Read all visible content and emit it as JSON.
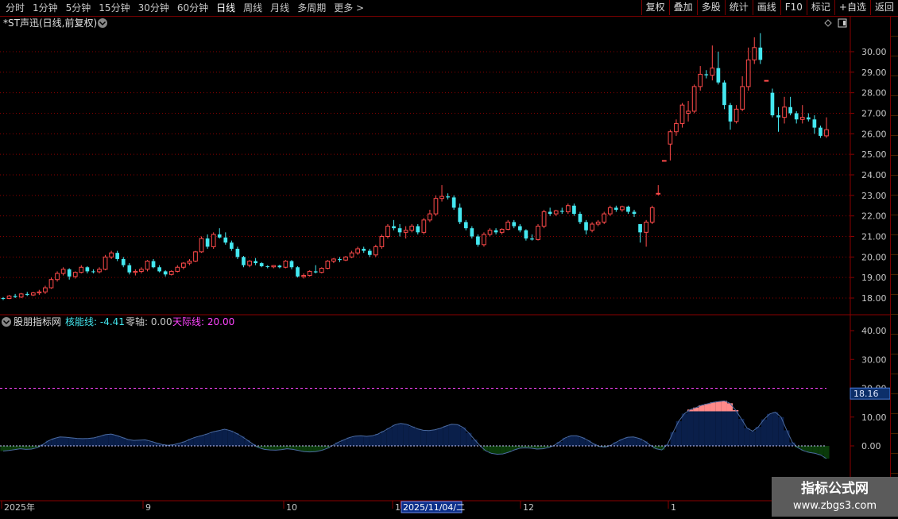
{
  "toolbar": {
    "periods": [
      "分时",
      "1分钟",
      "5分钟",
      "15分钟",
      "30分钟",
      "60分钟",
      "日线",
      "周线",
      "月线",
      "多周期",
      "更多 >"
    ],
    "active_period": "日线",
    "buttons": [
      "复权",
      "叠加",
      "多股",
      "统计",
      "画线",
      "F10",
      "标记",
      "+自选",
      "返回"
    ]
  },
  "main_chart": {
    "title": "*ST声迅(日线,前复权)",
    "y_ticks": [
      "30.00",
      "29.00",
      "28.00",
      "27.00",
      "26.00",
      "25.00",
      "24.00",
      "23.00",
      "22.00",
      "21.00",
      "20.00",
      "19.00",
      "18.00"
    ]
  },
  "indicator": {
    "name": "股朋指标网",
    "line1_label": "核能线: -4.41",
    "line2_label": "零轴: 0.00",
    "line3_label": "天际线: 20.00",
    "y_ticks": [
      "40.00",
      "30.00",
      "20.00",
      "10.00",
      "0.00"
    ],
    "level_badge": "18.16"
  },
  "date_axis": {
    "labels": [
      "2025年",
      "9",
      "10",
      "1",
      "2025/11/04/二",
      "12",
      "1"
    ],
    "highlight": "2025/11/04/二"
  },
  "watermark": {
    "title": "指标公式网",
    "url": "www.zbgs3.com"
  },
  "colors": {
    "up": "#ff4a4a",
    "down": "#44e8f0",
    "grid_dots": "#8a0000",
    "skyline": "#ff44ff",
    "energy_pos": "#0a1f4a",
    "energy_neg": "#0a3a0a",
    "energy_hi": "#ff8a8a"
  },
  "chart_data": {
    "type": "candlestick",
    "candles": [
      [
        18.0,
        18.05,
        17.9,
        17.98
      ],
      [
        17.98,
        18.15,
        17.95,
        18.1
      ],
      [
        18.1,
        18.2,
        18.0,
        18.05
      ],
      [
        18.05,
        18.25,
        18.0,
        18.2
      ],
      [
        18.2,
        18.3,
        18.1,
        18.15
      ],
      [
        18.15,
        18.3,
        18.1,
        18.25
      ],
      [
        18.25,
        18.4,
        18.15,
        18.3
      ],
      [
        18.3,
        18.6,
        18.2,
        18.5
      ],
      [
        18.5,
        19.0,
        18.45,
        18.9
      ],
      [
        18.9,
        19.3,
        18.8,
        19.2
      ],
      [
        19.2,
        19.5,
        19.1,
        19.4
      ],
      [
        19.4,
        19.45,
        18.9,
        19.05
      ],
      [
        19.05,
        19.3,
        18.95,
        19.25
      ],
      [
        19.25,
        19.6,
        19.2,
        19.5
      ],
      [
        19.5,
        19.55,
        19.2,
        19.3
      ],
      [
        19.3,
        19.4,
        19.2,
        19.28
      ],
      [
        19.28,
        19.5,
        19.2,
        19.4
      ],
      [
        19.4,
        20.1,
        19.35,
        20.0
      ],
      [
        20.0,
        20.3,
        19.9,
        20.2
      ],
      [
        20.2,
        20.3,
        19.8,
        19.9
      ],
      [
        19.9,
        20.0,
        19.5,
        19.6
      ],
      [
        19.6,
        19.7,
        19.15,
        19.25
      ],
      [
        19.25,
        19.4,
        19.1,
        19.3
      ],
      [
        19.3,
        19.5,
        19.2,
        19.4
      ],
      [
        19.4,
        19.85,
        19.3,
        19.8
      ],
      [
        19.8,
        19.9,
        19.45,
        19.5
      ],
      [
        19.5,
        19.6,
        19.25,
        19.3
      ],
      [
        19.3,
        19.35,
        19.05,
        19.15
      ],
      [
        19.15,
        19.35,
        19.1,
        19.3
      ],
      [
        19.3,
        19.6,
        19.25,
        19.5
      ],
      [
        19.5,
        19.75,
        19.4,
        19.7
      ],
      [
        19.7,
        19.9,
        19.6,
        19.8
      ],
      [
        19.8,
        20.3,
        19.75,
        20.25
      ],
      [
        20.25,
        21.0,
        20.2,
        20.9
      ],
      [
        20.9,
        21.1,
        20.4,
        20.5
      ],
      [
        20.5,
        21.2,
        20.4,
        21.1
      ],
      [
        21.1,
        21.4,
        20.9,
        20.95
      ],
      [
        20.95,
        21.2,
        20.6,
        20.7
      ],
      [
        20.7,
        20.8,
        20.3,
        20.4
      ],
      [
        20.4,
        20.5,
        19.9,
        20.0
      ],
      [
        20.0,
        20.05,
        19.5,
        19.6
      ],
      [
        19.6,
        19.85,
        19.5,
        19.8
      ],
      [
        19.8,
        19.95,
        19.6,
        19.7
      ],
      [
        19.7,
        19.75,
        19.5,
        19.55
      ],
      [
        19.55,
        19.6,
        19.45,
        19.52
      ],
      [
        19.52,
        19.6,
        19.45,
        19.58
      ],
      [
        19.58,
        19.62,
        19.45,
        19.5
      ],
      [
        19.5,
        19.85,
        19.45,
        19.8
      ],
      [
        19.8,
        19.85,
        19.4,
        19.5
      ],
      [
        19.5,
        19.55,
        19.0,
        19.05
      ],
      [
        19.05,
        19.2,
        18.95,
        19.1
      ],
      [
        19.1,
        19.35,
        19.05,
        19.3
      ],
      [
        19.3,
        19.6,
        19.2,
        19.25
      ],
      [
        19.25,
        19.5,
        19.2,
        19.45
      ],
      [
        19.45,
        19.85,
        19.4,
        19.8
      ],
      [
        19.8,
        19.95,
        19.7,
        19.9
      ],
      [
        19.9,
        20.0,
        19.75,
        19.85
      ],
      [
        19.85,
        20.05,
        19.8,
        20.0
      ],
      [
        20.0,
        20.3,
        19.95,
        20.2
      ],
      [
        20.2,
        20.5,
        20.1,
        20.4
      ],
      [
        20.4,
        20.5,
        20.2,
        20.3
      ],
      [
        20.3,
        20.4,
        20.0,
        20.1
      ],
      [
        20.1,
        20.6,
        20.0,
        20.5
      ],
      [
        20.5,
        21.1,
        20.4,
        21.0
      ],
      [
        21.0,
        21.6,
        20.9,
        21.5
      ],
      [
        21.5,
        21.8,
        21.3,
        21.4
      ],
      [
        21.4,
        21.6,
        21.0,
        21.2
      ],
      [
        21.2,
        21.5,
        20.9,
        21.3
      ],
      [
        21.3,
        21.6,
        21.2,
        21.5
      ],
      [
        21.5,
        21.6,
        21.1,
        21.2
      ],
      [
        21.2,
        21.9,
        21.1,
        21.8
      ],
      [
        21.8,
        22.3,
        21.7,
        22.1
      ],
      [
        22.1,
        23.0,
        22.0,
        22.85
      ],
      [
        22.85,
        23.5,
        22.7,
        22.95
      ],
      [
        22.95,
        23.1,
        22.8,
        22.9
      ],
      [
        22.9,
        23.0,
        22.3,
        22.4
      ],
      [
        22.4,
        22.6,
        21.6,
        21.7
      ],
      [
        21.7,
        21.8,
        21.3,
        21.4
      ],
      [
        21.4,
        21.5,
        20.9,
        21.0
      ],
      [
        21.0,
        21.1,
        20.5,
        20.6
      ],
      [
        20.6,
        21.2,
        20.5,
        21.1
      ],
      [
        21.1,
        21.4,
        21.0,
        21.3
      ],
      [
        21.3,
        21.4,
        21.1,
        21.2
      ],
      [
        21.2,
        21.4,
        21.1,
        21.35
      ],
      [
        21.35,
        21.8,
        21.3,
        21.7
      ],
      [
        21.7,
        21.8,
        21.4,
        21.5
      ],
      [
        21.5,
        21.6,
        21.2,
        21.3
      ],
      [
        21.3,
        21.35,
        20.8,
        20.9
      ],
      [
        20.9,
        21.1,
        20.8,
        20.85
      ],
      [
        20.85,
        21.6,
        20.8,
        21.5
      ],
      [
        21.5,
        22.3,
        21.4,
        22.2
      ],
      [
        22.2,
        22.4,
        22.0,
        22.1
      ],
      [
        22.1,
        22.3,
        22.0,
        22.25
      ],
      [
        22.25,
        22.4,
        22.1,
        22.2
      ],
      [
        22.2,
        22.6,
        22.1,
        22.5
      ],
      [
        22.5,
        22.6,
        22.0,
        22.1
      ],
      [
        22.1,
        22.2,
        21.6,
        21.7
      ],
      [
        21.7,
        21.8,
        21.1,
        21.3
      ],
      [
        21.3,
        21.7,
        21.2,
        21.6
      ],
      [
        21.6,
        21.8,
        21.5,
        21.7
      ],
      [
        21.7,
        22.2,
        21.6,
        22.1
      ],
      [
        22.1,
        22.5,
        22.0,
        22.4
      ],
      [
        22.4,
        22.5,
        22.2,
        22.3
      ],
      [
        22.3,
        22.5,
        22.2,
        22.45
      ],
      [
        22.45,
        22.5,
        22.1,
        22.2
      ],
      [
        22.2,
        22.3,
        21.95,
        22.1
      ],
      [
        21.6,
        21.6,
        20.7,
        21.2
      ],
      [
        21.2,
        21.8,
        20.5,
        21.7
      ],
      [
        21.7,
        22.5,
        21.6,
        22.4
      ],
      [
        23.1,
        23.5,
        23.0,
        23.1
      ],
      [
        24.7,
        24.7,
        24.7,
        24.7
      ],
      [
        25.5,
        26.2,
        24.7,
        26.1
      ],
      [
        26.1,
        26.7,
        25.9,
        26.5
      ],
      [
        26.5,
        27.5,
        26.3,
        27.4
      ],
      [
        27.0,
        27.6,
        26.6,
        27.1
      ],
      [
        27.1,
        28.4,
        27.0,
        28.3
      ],
      [
        28.3,
        29.3,
        28.1,
        28.9
      ],
      [
        28.9,
        29.1,
        28.7,
        28.85
      ],
      [
        28.85,
        30.3,
        28.6,
        29.2
      ],
      [
        29.2,
        30.0,
        28.4,
        28.5
      ],
      [
        28.5,
        28.6,
        27.2,
        27.4
      ],
      [
        27.4,
        27.5,
        26.2,
        26.6
      ],
      [
        26.6,
        27.4,
        26.5,
        27.2
      ],
      [
        27.2,
        28.8,
        27.1,
        28.3
      ],
      [
        28.3,
        30.2,
        28.1,
        29.6
      ],
      [
        29.6,
        30.7,
        29.4,
        30.2
      ],
      [
        30.2,
        30.9,
        29.4,
        29.6
      ],
      [
        28.6,
        28.6,
        28.6,
        28.6
      ],
      [
        28.0,
        28.2,
        26.8,
        26.9
      ],
      [
        26.9,
        27.3,
        26.1,
        26.8
      ],
      [
        26.8,
        27.8,
        26.5,
        27.3
      ],
      [
        27.3,
        27.8,
        26.9,
        27.0
      ],
      [
        27.0,
        27.1,
        26.5,
        26.7
      ],
      [
        26.7,
        27.4,
        26.5,
        26.8
      ],
      [
        26.8,
        27.0,
        26.6,
        26.7
      ],
      [
        26.7,
        26.9,
        26.0,
        26.3
      ],
      [
        26.3,
        26.4,
        25.8,
        25.9
      ],
      [
        25.9,
        26.8,
        25.8,
        26.2
      ]
    ],
    "indicator_series": [
      {
        "name": "核能线",
        "values": [
          -1.8,
          -1.6,
          -1.3,
          -1.0,
          -1.2,
          -1.1,
          -0.6,
          0.5,
          1.8,
          2.6,
          3.1,
          3.0,
          2.8,
          2.6,
          2.5,
          2.6,
          2.8,
          3.3,
          3.9,
          4.1,
          3.6,
          2.9,
          2.2,
          1.9,
          2.0,
          2.1,
          1.6,
          1.0,
          0.5,
          0.2,
          0.4,
          0.9,
          1.5,
          2.4,
          3.1,
          3.6,
          4.2,
          4.9,
          5.3,
          5.8,
          5.3,
          4.4,
          3.3,
          2.0,
          0.6,
          -0.6,
          -1.2,
          -1.4,
          -1.5,
          -1.3,
          -1.0,
          -1.2,
          -1.6,
          -2.0,
          -2.1,
          -2.0,
          -1.6,
          -0.9,
          0.1,
          1.2,
          2.1,
          2.9,
          3.4,
          3.5,
          3.3,
          3.5,
          4.1,
          5.1,
          6.2,
          7.3,
          7.8,
          7.5,
          6.7,
          5.9,
          5.4,
          5.3,
          5.6,
          6.1,
          6.9,
          7.5,
          7.4,
          6.4,
          4.5,
          2.2,
          0.0,
          -1.7,
          -2.6,
          -2.9,
          -2.8,
          -2.2,
          -1.4,
          -0.8,
          -0.7,
          -0.8,
          -1.1,
          -1.0,
          -0.6,
          0.1,
          1.4,
          2.8,
          3.5,
          3.5,
          2.9,
          1.9,
          0.7,
          -0.2,
          -0.4,
          0.2,
          1.3,
          2.3,
          3.0,
          3.1,
          2.6,
          1.6,
          0.2,
          -1.0,
          -1.4,
          0.5,
          4.8,
          8.6,
          11.2,
          12.6,
          13.3,
          14.1,
          14.6,
          15.1,
          15.4,
          15.6,
          14.8,
          12.4,
          9.4,
          6.2,
          5.1,
          6.6,
          9.2,
          11.1,
          11.7,
          10.0,
          5.4,
          1.2,
          -0.7,
          -1.7,
          -2.3,
          -2.6,
          -3.2,
          -4.41
        ]
      }
    ],
    "skyline": 20.0,
    "zero_axis": 0.0,
    "ylim_main": [
      17.5,
      31.3
    ],
    "ylim_indicator": [
      -5,
      44
    ]
  }
}
